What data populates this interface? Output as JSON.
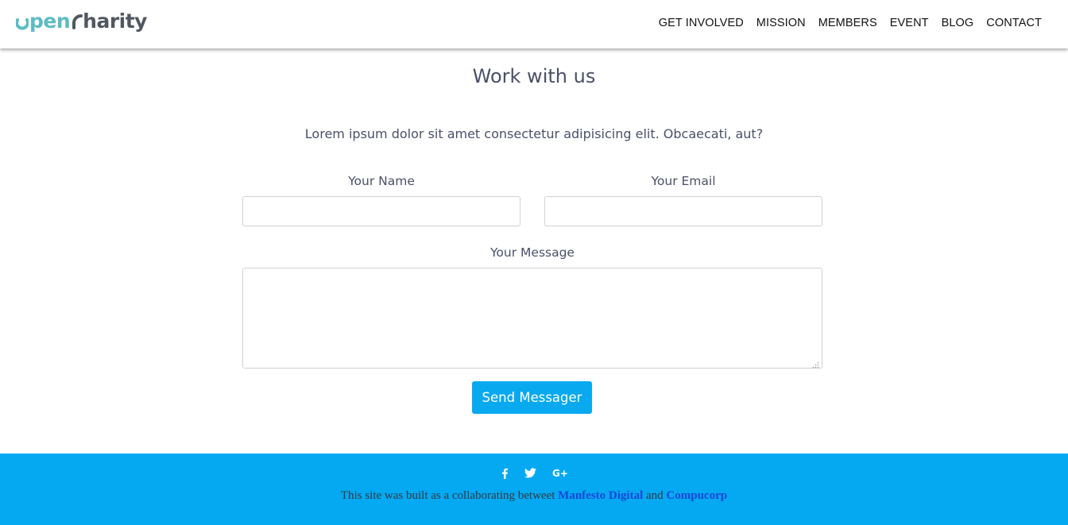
{
  "header": {
    "logo": {
      "part1": "pen",
      "part2": "harity"
    },
    "nav": [
      "GET INVOLVED",
      "MISSION",
      "MEMBERS",
      "EVENT",
      "BLOG",
      "CONTACT"
    ]
  },
  "main": {
    "title": "Work with us",
    "intro": "Lorem ipsum dolor sit amet consectetur adipisicing elit. Obcaecati, aut?",
    "form": {
      "name_label": "Your Name",
      "name_value": "",
      "email_label": "Your Email",
      "email_value": "",
      "message_label": "Your Message",
      "message_value": "",
      "submit_label": "Send Messager"
    }
  },
  "footer": {
    "social": [
      {
        "icon": "facebook-icon",
        "glyph": "f"
      },
      {
        "icon": "twitter-icon",
        "glyph": "🐦"
      },
      {
        "icon": "google-plus-icon",
        "glyph": "G+"
      }
    ],
    "credits_prefix": "This site was built as a collaborating betweet",
    "link1": "Manfesto Digital",
    "conjunction": "and",
    "link2": "Compucorp"
  },
  "colors": {
    "brand_teal": "#5cbcc4",
    "brand_gray": "#505760",
    "accent_blue": "#08a9ef",
    "footer_blue": "#04a9f2",
    "link_blue": "#1a47d6"
  }
}
